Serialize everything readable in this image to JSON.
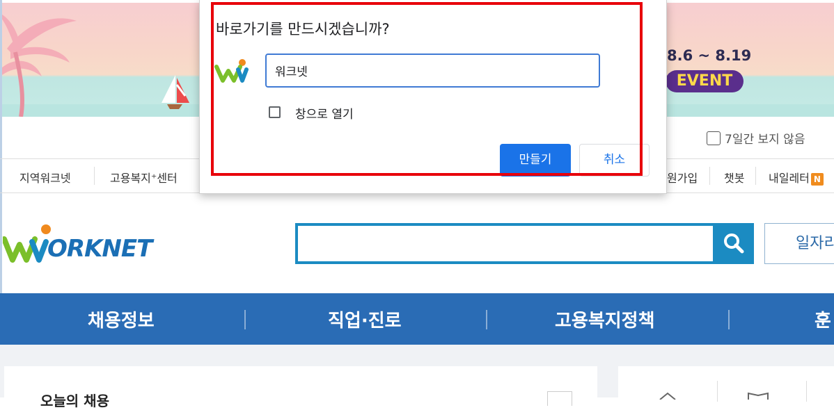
{
  "banner": {
    "event_dates": "8.6 ~ 8.19",
    "event_label": "EVENT"
  },
  "no_show_today": "7일간 보지 않음",
  "utility_nav": {
    "items": [
      {
        "label": "지역워크넷"
      },
      {
        "label": "고용복지⁺센터"
      },
      {
        "label": "원가입"
      },
      {
        "label": "챗봇"
      },
      {
        "label": "내일레터"
      }
    ],
    "badge": "N"
  },
  "logo_text": "ORKNET",
  "search": {
    "placeholder": "",
    "side_button": "일자리"
  },
  "main_nav": {
    "items": [
      {
        "label": "채용정보"
      },
      {
        "label": "직업·진로"
      },
      {
        "label": "고용복지정책"
      },
      {
        "label": "훈"
      }
    ]
  },
  "content": {
    "card_title": "오늘의 채용"
  },
  "dialog": {
    "title": "바로가기를 만드시겠습니까?",
    "name_value": "워크넷",
    "open_as_window_label": "창으로 열기",
    "open_as_window_checked": false,
    "create_label": "만들기",
    "cancel_label": "취소"
  },
  "colors": {
    "highlight_box": "#e8000a",
    "primary_button": "#1a73e8",
    "main_nav_bg": "#2a6cb5",
    "search_accent": "#1b8bc2"
  }
}
